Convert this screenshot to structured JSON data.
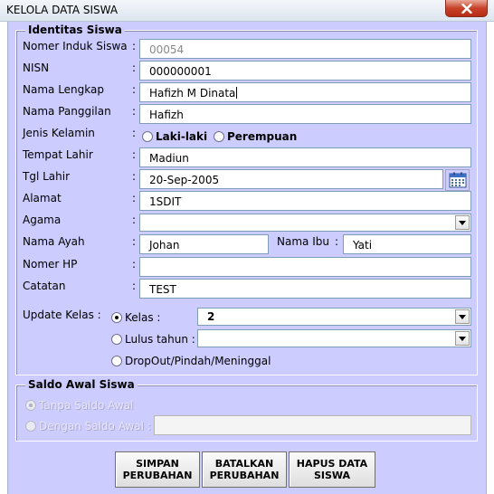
{
  "window": {
    "title": "KELOLA DATA SISWA",
    "close_icon": "close-icon"
  },
  "identitas": {
    "group_title": "Identitas Siswa",
    "nis": {
      "label": "Nomer Induk Siswa",
      "value": "00054"
    },
    "nisn": {
      "label": "NISN",
      "value": "000000001"
    },
    "nama_lengkap": {
      "label": "Nama Lengkap",
      "value": "Hafizh M Dinata"
    },
    "nama_panggilan": {
      "label": "Nama Panggilan",
      "value": "Hafizh"
    },
    "jenis_kelamin": {
      "label": "Jenis Kelamin",
      "options": [
        "Laki-laki",
        "Perempuan"
      ],
      "selected": null
    },
    "tempat_lahir": {
      "label": "Tempat Lahir",
      "value": "Madiun"
    },
    "tgl_lahir": {
      "label": "Tgl Lahir",
      "value": "20-Sep-2005",
      "icon": "calendar-icon"
    },
    "alamat": {
      "label": "Alamat",
      "value": "1SDIT"
    },
    "agama": {
      "label": "Agama",
      "value": ""
    },
    "nama_ayah": {
      "label": "Nama Ayah",
      "value": "Johan"
    },
    "nama_ibu": {
      "label": "Nama Ibu",
      "value": "Yati"
    },
    "nomer_hp": {
      "label": "Nomer HP",
      "value": ""
    },
    "catatan": {
      "label": "Catatan",
      "value": "TEST"
    },
    "colon": ":",
    "update_kelas": {
      "label": "Update Kelas :",
      "kelas_option": "Kelas :",
      "kelas_value": "2",
      "lulus_option": "Lulus tahun :",
      "lulus_value": "",
      "dropout_option": "DropOut/Pindah/Meninggal",
      "selected": "Kelas :"
    }
  },
  "saldo": {
    "group_title": "Saldo Awal Siswa",
    "tanpa_option": "Tanpa Saldo Awal",
    "dengan_option": "Dengan Saldo Awal :",
    "dengan_value": "",
    "selected": "Tanpa Saldo Awal"
  },
  "buttons": {
    "simpan": "SIMPAN\nPERUBAHAN",
    "batalkan": "BATALKAN\nPERUBAHAN",
    "hapus": "HAPUS DATA\nSISWA"
  },
  "colors": {
    "form_bg": "#ccccff",
    "close_button": "#c7432a"
  }
}
